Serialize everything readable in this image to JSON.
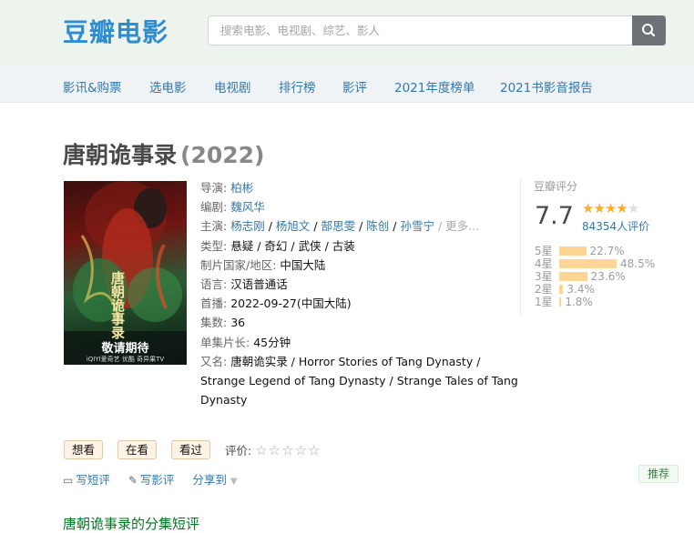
{
  "header": {
    "logo_text": "豆瓣电影",
    "search_placeholder": "搜索电影、电视剧、综艺、影人",
    "search_icon": "search-icon",
    "bg_color": "#edf4ed"
  },
  "nav": {
    "items": [
      "影讯&购票",
      "选电影",
      "电视剧",
      "排行榜",
      "影评",
      "2021年度榜单",
      "2021书影音报告"
    ]
  },
  "title": {
    "name": "唐朝诡事录",
    "year": "(2022)"
  },
  "poster": {
    "title_glyphs": "唐朝诡事录",
    "caption": "敬请期待",
    "platforms": "iQIYI爱奇艺  优酷  奇异果TV"
  },
  "info": {
    "director_label": "导演:",
    "director": "柏彬",
    "writer_label": "编剧:",
    "writer": "魏风华",
    "cast_label": "主演:",
    "cast": [
      "杨志刚",
      "杨旭文",
      "郜思雯",
      "陈创",
      "孙雪宁"
    ],
    "cast_more": "更多...",
    "genre_label": "类型:",
    "genres": [
      "悬疑",
      "奇幻",
      "武侠",
      "古装"
    ],
    "region_label": "制片国家/地区:",
    "region": "中国大陆",
    "language_label": "语言:",
    "language": "汉语普通话",
    "premiere_label": "首播:",
    "premiere": "2022-09-27(中国大陆)",
    "episodes_label": "集数:",
    "episodes": "36",
    "runtime_label": "单集片长:",
    "runtime": "45分钟",
    "aka_label": "又名:",
    "aka_line1": "唐朝诡实录 / Horror Stories of Tang Dynasty /",
    "aka_line2": "Strange Legend of Tang Dynasty / Strange Tales of Tang",
    "aka_line3": "Dynasty"
  },
  "rating": {
    "label": "豆瓣评分",
    "score": "7.7",
    "stars_filled": 4,
    "votes": "84354人评价",
    "distribution": [
      {
        "label": "5星",
        "percent": 22.7,
        "text": "22.7%"
      },
      {
        "label": "4星",
        "percent": 48.5,
        "text": "48.5%"
      },
      {
        "label": "3星",
        "percent": 23.6,
        "text": "23.6%"
      },
      {
        "label": "2星",
        "percent": 3.4,
        "text": "3.4%"
      },
      {
        "label": "1星",
        "percent": 1.8,
        "text": "1.8%"
      }
    ],
    "star_color": "#ffac2d",
    "bar_color": "#ffd596"
  },
  "actions": {
    "want": "想看",
    "watching": "在看",
    "watched": "看过",
    "eval_label": "评价:",
    "short_review": "写短评",
    "review": "写影评",
    "share": "分享到",
    "recommend": "推荐"
  },
  "section_title": "唐朝诡事录的分集短评"
}
